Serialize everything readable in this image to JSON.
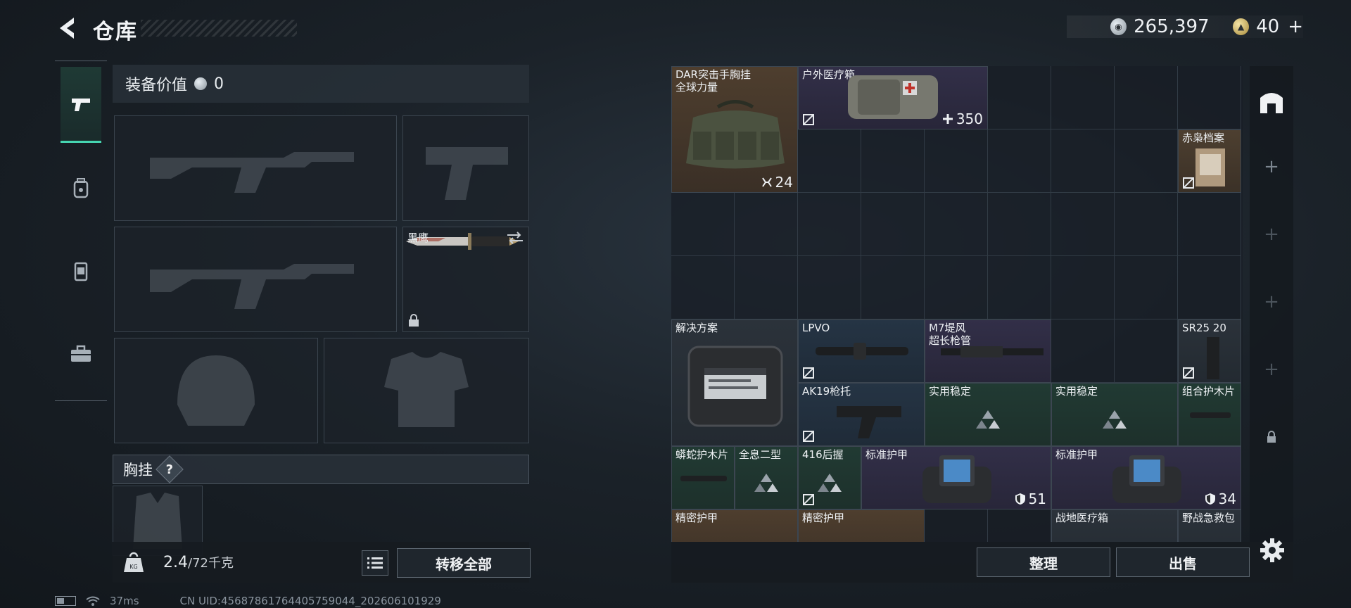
{
  "header": {
    "title": "仓库",
    "currency_silver": "265,397",
    "currency_gold": "40",
    "add_label": "+"
  },
  "left_tabs": [
    {
      "icon": "pistol-icon",
      "active": true
    },
    {
      "icon": "backpack-icon",
      "active": false
    },
    {
      "icon": "vest-icon",
      "active": false
    },
    {
      "icon": "toolbox-icon",
      "active": false
    }
  ],
  "equipment": {
    "value_label": "装备价值",
    "value": "0",
    "knife_name": "黑鹰",
    "chest_label": "胸挂",
    "chest_help": "?"
  },
  "weight": {
    "current": "2.4",
    "max": "/72千克"
  },
  "buttons": {
    "transfer_all": "转移全部",
    "sort": "整理",
    "sell": "出售"
  },
  "status": {
    "ping": "37ms",
    "uid": "CN UID:456878617644057590​44_202606101929"
  },
  "stash_items": [
    {
      "name": "DAR突击手胸挂",
      "sub": "全球力量",
      "count": "24",
      "count_icon": "slots-icon"
    },
    {
      "name": "户外医疗箱",
      "count": "350",
      "count_icon": "plus-icon",
      "badge": "no-insure-icon"
    },
    {
      "name": "赤枭档案",
      "badge": "no-insure-icon"
    },
    {
      "name": "解决方案"
    },
    {
      "name": "LPVO",
      "badge": "no-insure-icon"
    },
    {
      "name": "M7堤风",
      "sub": "超长枪管"
    },
    {
      "name": "SR25 20",
      "badge": "no-insure-icon"
    },
    {
      "name": "AK19枪托",
      "badge": "no-insure-icon"
    },
    {
      "name": "实用稳定"
    },
    {
      "name": "实用稳定"
    },
    {
      "name": "组合护木片"
    },
    {
      "name": "蟒蛇护木片"
    },
    {
      "name": "全息二型"
    },
    {
      "name": "416后握",
      "badge": "no-insure-icon"
    },
    {
      "name": "标准护甲",
      "count": "51",
      "count_icon": "shield-icon"
    },
    {
      "name": "标准护甲",
      "count": "34",
      "count_icon": "shield-icon"
    },
    {
      "name": "精密护甲"
    },
    {
      "name": "精密护甲"
    },
    {
      "name": "战地医疗箱"
    },
    {
      "name": "野战急救包"
    }
  ],
  "colors": {
    "accent": "#46d5b1",
    "rarity_brown": "#4e3e2e",
    "rarity_purple": "#322f48",
    "rarity_blue": "#253444",
    "rarity_green": "#213a33"
  }
}
